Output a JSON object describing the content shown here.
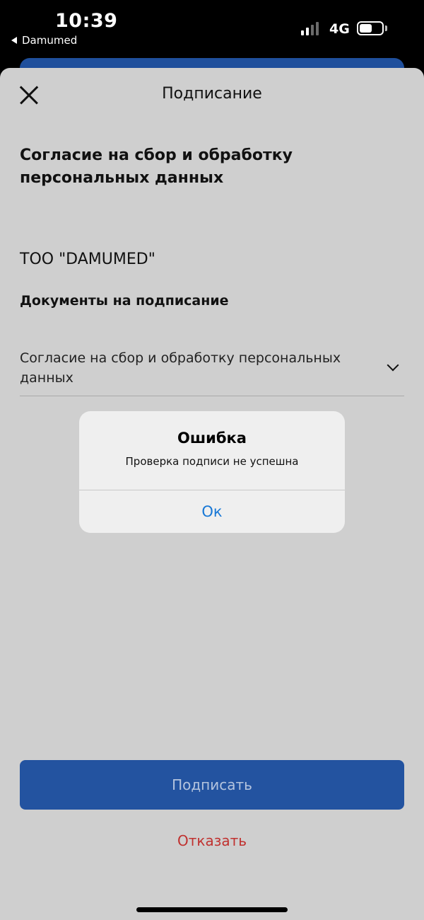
{
  "status_bar": {
    "time": "10:39",
    "back_app": "Damumed",
    "network": "4G",
    "battery_level": 0.55,
    "signal_bars_active": 2,
    "signal_bars_total": 4
  },
  "sheet": {
    "title": "Подписание",
    "heading": "Согласие на сбор и обработку персональных данных",
    "organization": "ТОО \"DAMUMED\"",
    "documents_label": "Документы на подписание",
    "documents": [
      {
        "title": "Согласие на сбор и обработку персональных данных"
      }
    ]
  },
  "actions": {
    "sign_label": "Подписать",
    "decline_label": "Отказать"
  },
  "alert": {
    "title": "Ошибка",
    "message": "Проверка подписи не успешна",
    "ok_label": "Ок"
  },
  "colors": {
    "primary": "#2353a0",
    "decline": "#c0312f",
    "alert_link": "#1878d6",
    "sheet_background": "#cfcfcf"
  }
}
